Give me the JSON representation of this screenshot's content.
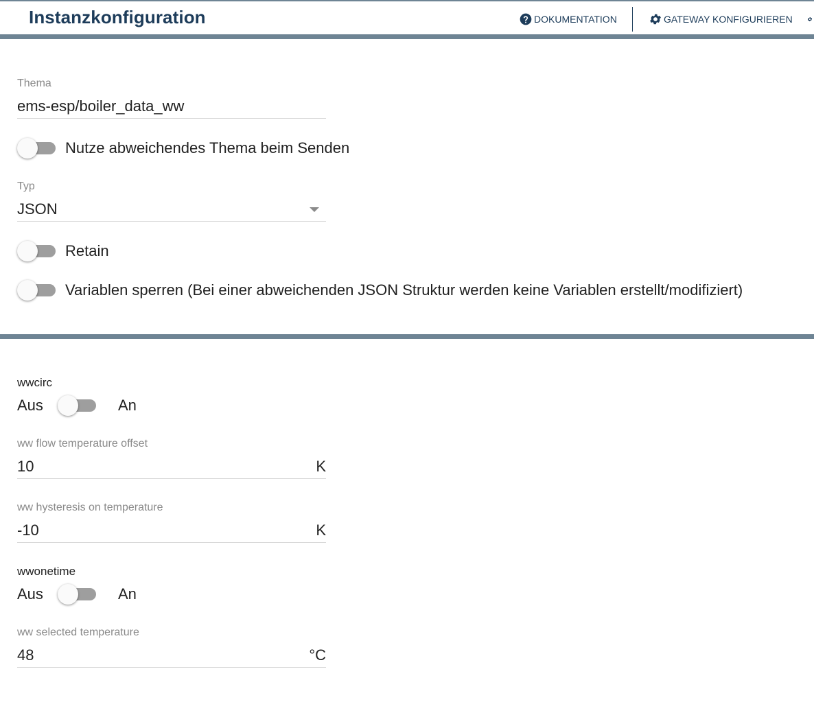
{
  "header": {
    "title": "Instanzkonfiguration",
    "doc_label": "DOKUMENTATION",
    "gateway_label": "GATEWAY KONFIGURIEREN",
    "accent": "#1d3c5a",
    "bar_color": "#6e8494"
  },
  "config": {
    "topic": {
      "label": "Thema",
      "value": "ems-esp/boiler_data_ww"
    },
    "alt_topic": {
      "label": "Nutze abweichendes Thema beim Senden",
      "checked": false
    },
    "type": {
      "label": "Typ",
      "value": "JSON"
    },
    "retain": {
      "label": "Retain",
      "checked": false
    },
    "lock_vars": {
      "label": "Variablen sperren (Bei einer abweichenden JSON Struktur werden keine Variablen erstellt/modifiziert)",
      "checked": false
    }
  },
  "variables": {
    "wwcirc": {
      "label": "wwcirc",
      "off": "Aus",
      "on": "An",
      "checked": false
    },
    "flow_offset": {
      "label": "ww flow temperature offset",
      "value": "10",
      "unit": "K"
    },
    "hysteresis_on": {
      "label": "ww hysteresis on temperature",
      "value": "-10",
      "unit": "K"
    },
    "wwonetime": {
      "label": "wwonetime",
      "off": "Aus",
      "on": "An",
      "checked": false
    },
    "selected_temp": {
      "label": "ww selected temperature",
      "value": "48",
      "unit": "°C"
    }
  },
  "icons": {
    "doc": "help-circle-icon",
    "gateway": "gear-icon",
    "more": "gear-icon"
  }
}
